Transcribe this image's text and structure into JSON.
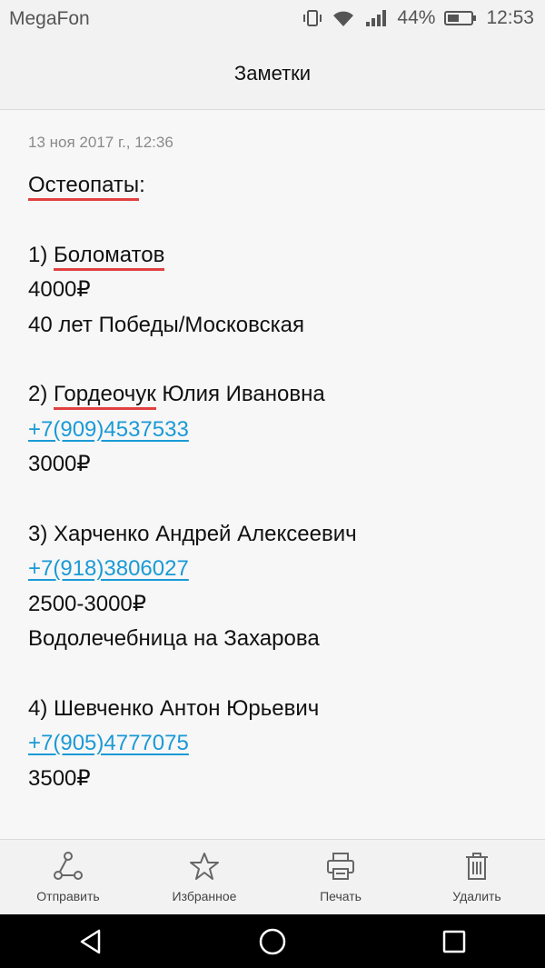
{
  "status": {
    "carrier": "MegaFon",
    "battery": "44%",
    "time": "12:53",
    "icons": [
      "vibrate-icon",
      "wifi-icon",
      "signal-icon",
      "battery-icon"
    ]
  },
  "header": {
    "title": "Заметки"
  },
  "note": {
    "date": "13 ноя 2017 г., 12:36",
    "heading": "Остеопаты",
    "heading_suffix": ":",
    "entries": [
      {
        "num": "1) ",
        "name_misspelled": "Боломатов",
        "name_rest": "",
        "phone": "",
        "price": "4000₽",
        "address": "40 лет Победы/Московская"
      },
      {
        "num": "2) ",
        "name_misspelled": "Гордеочук",
        "name_rest": " Юлия Ивановна",
        "phone": "+7(909)4537533",
        "price": "3000₽",
        "address": ""
      },
      {
        "num": "3) ",
        "name_misspelled": "",
        "name_rest": "Харченко Андрей Алексеевич",
        "phone": "+7(918)3806027",
        "price": "2500-3000₽",
        "address": "Водолечебница на Захарова"
      },
      {
        "num": "4) ",
        "name_misspelled": "",
        "name_rest": "Шевченко Антон Юрьевич",
        "phone": "+7(905)4777075",
        "price": "3500₽",
        "address": ""
      }
    ]
  },
  "toolbar": {
    "send": "Отправить",
    "favorite": "Избранное",
    "print": "Печать",
    "delete": "Удалить"
  },
  "colors": {
    "link": "#1a9ad6",
    "spellcheck": "#e02828"
  }
}
